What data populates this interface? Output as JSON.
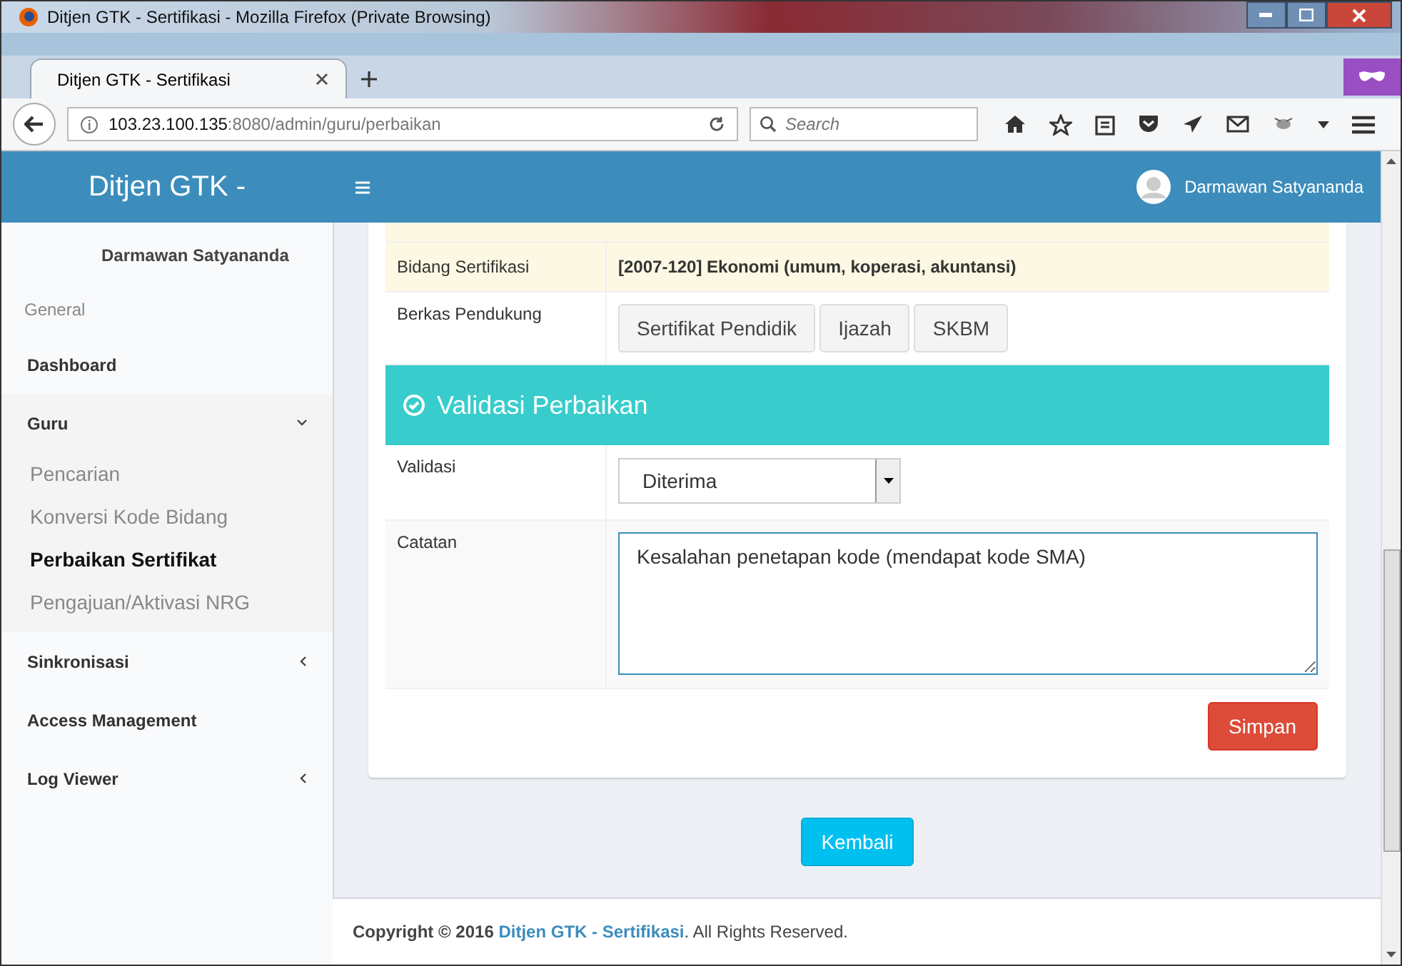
{
  "window": {
    "title": "Ditjen GTK - Sertifikasi - Mozilla Firefox (Private Browsing)"
  },
  "tabs": [
    {
      "label": "Ditjen GTK - Sertifikasi",
      "selected": true
    }
  ],
  "address": {
    "host": "103.23.100.135",
    "rest": ":8080/admin/guru/perbaikan"
  },
  "search": {
    "placeholder": "Search"
  },
  "header": {
    "brand": "Ditjen GTK -",
    "user": "Darmawan Satyananda"
  },
  "sidebar": {
    "user": "Darmawan Satyananda",
    "section": "General",
    "items": [
      {
        "label": "Dashboard",
        "kind": "plain"
      },
      {
        "label": "Guru",
        "kind": "menu",
        "expanded": true,
        "children": [
          {
            "label": "Pencarian",
            "selected": false
          },
          {
            "label": "Konversi Kode Bidang",
            "selected": false
          },
          {
            "label": "Perbaikan Sertifikat",
            "selected": true
          },
          {
            "label": "Pengajuan/Aktivasi NRG",
            "selected": false
          }
        ]
      },
      {
        "label": "Sinkronisasi",
        "kind": "menu",
        "expanded": false
      },
      {
        "label": "Access Management",
        "kind": "plain"
      },
      {
        "label": "Log Viewer",
        "kind": "menu",
        "expanded": false
      }
    ]
  },
  "detail": {
    "bidang_label": "Bidang Sertifikasi",
    "bidang_value": "[2007-120] Ekonomi (umum, koperasi, akuntansi)",
    "berkas_label": "Berkas Pendukung",
    "berkas_buttons": [
      "Sertifikat Pendidik",
      "Ijazah",
      "SKBM"
    ]
  },
  "validation": {
    "title": "Validasi Perbaikan",
    "validasi_label": "Validasi",
    "validasi_value": "Diterima",
    "catatan_label": "Catatan",
    "catatan_value": "Kesalahan penetapan kode (mendapat kode SMA)",
    "save": "Simpan"
  },
  "back": "Kembali",
  "footer": {
    "prefix": "Copyright © 2016",
    "link": "Ditjen GTK - Sertifikasi",
    "suffix": ". All Rights Reserved."
  }
}
